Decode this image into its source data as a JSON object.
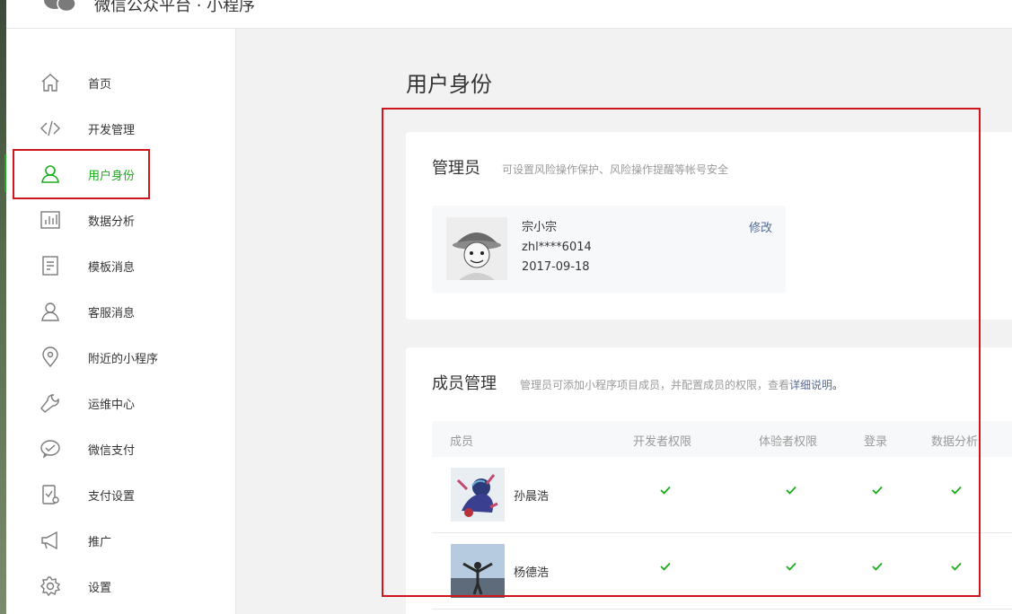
{
  "app": {
    "title": "微信公众平台 · 小程序",
    "brand_color": "#1aad19",
    "highlight_color": "#d0151c",
    "link_color": "#576b95"
  },
  "sidebar": {
    "items": [
      {
        "label": "首页",
        "icon": "home-icon"
      },
      {
        "label": "开发管理",
        "icon": "code-icon"
      },
      {
        "label": "用户身份",
        "icon": "user-icon",
        "active": true
      },
      {
        "label": "数据分析",
        "icon": "bar-chart-icon"
      },
      {
        "label": "模板消息",
        "icon": "document-icon"
      },
      {
        "label": "客服消息",
        "icon": "customer-service-icon"
      },
      {
        "label": "附近的小程序",
        "icon": "location-pin-icon"
      },
      {
        "label": "运维中心",
        "icon": "wrench-icon"
      },
      {
        "label": "微信支付",
        "icon": "payment-icon"
      },
      {
        "label": "支付设置",
        "icon": "payment-settings-icon"
      },
      {
        "label": "推广",
        "icon": "megaphone-icon"
      },
      {
        "label": "设置",
        "icon": "gear-icon"
      }
    ]
  },
  "main": {
    "page_title": "用户身份",
    "admin_card": {
      "heading": "管理员",
      "subtitle": "可设置风险操作保护、风险操作提醒等帐号安全",
      "admin": {
        "name": "宗小宗",
        "account": "zhl****6014",
        "date": "2017-09-18",
        "edit_label": "修改"
      }
    },
    "members_card": {
      "heading": "成员管理",
      "subtitle_prefix": "管理员可添加小程序项目成员，并配置成员的权限，查看",
      "subtitle_link": "详细说明",
      "subtitle_suffix": "。",
      "columns": [
        "成员",
        "开发者权限",
        "体验者权限",
        "登录",
        "数据分析"
      ],
      "rows": [
        {
          "name": "孙晨浩",
          "permissions": [
            true,
            true,
            true,
            true
          ]
        },
        {
          "name": "杨德浩",
          "permissions": [
            true,
            true,
            true,
            true
          ]
        }
      ]
    }
  }
}
